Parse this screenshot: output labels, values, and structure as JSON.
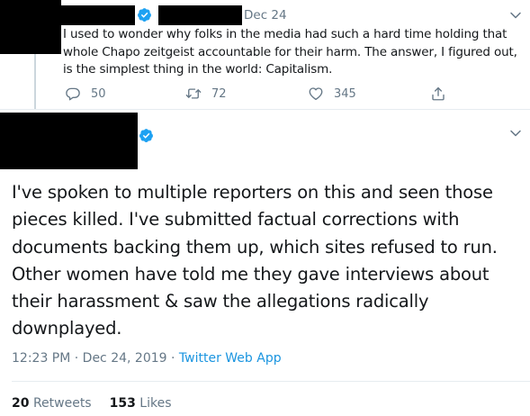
{
  "reply_tweet": {
    "date": "Dec 24",
    "text_lines": [
      "I used to wonder why folks in the media had such a hard time holding that",
      "whole Chapo zeitgeist accountable for their harm. The answer, I figured out,",
      "is the simplest thing in the world: Capitalism."
    ],
    "actions": {
      "reply_count": "50",
      "retweet_count": "72",
      "like_count": "345"
    }
  },
  "main_tweet": {
    "text_lines": [
      "I've spoken to multiple reporters on this and seen those",
      "pieces killed. I've submitted factual corrections with",
      "documents backing them up, which sites refused to run.",
      "Other women have told me they gave interviews about",
      "their harassment & saw the allegations radically",
      "downplayed."
    ],
    "timestamp": "12:23 PM · Dec 24, 2019 · ",
    "source": "Twitter Web App",
    "retweets": "20",
    "retweets_label": "Retweets",
    "likes": "153",
    "likes_label": "Likes"
  },
  "colors": {
    "verified": "#1da1f2",
    "secondary_text": "#657786",
    "link": "#1b95e0",
    "redaction": "#000000"
  },
  "icons": [
    "verified-icon",
    "chevron-down-icon",
    "reply-icon",
    "retweet-icon",
    "like-icon",
    "share-icon"
  ]
}
